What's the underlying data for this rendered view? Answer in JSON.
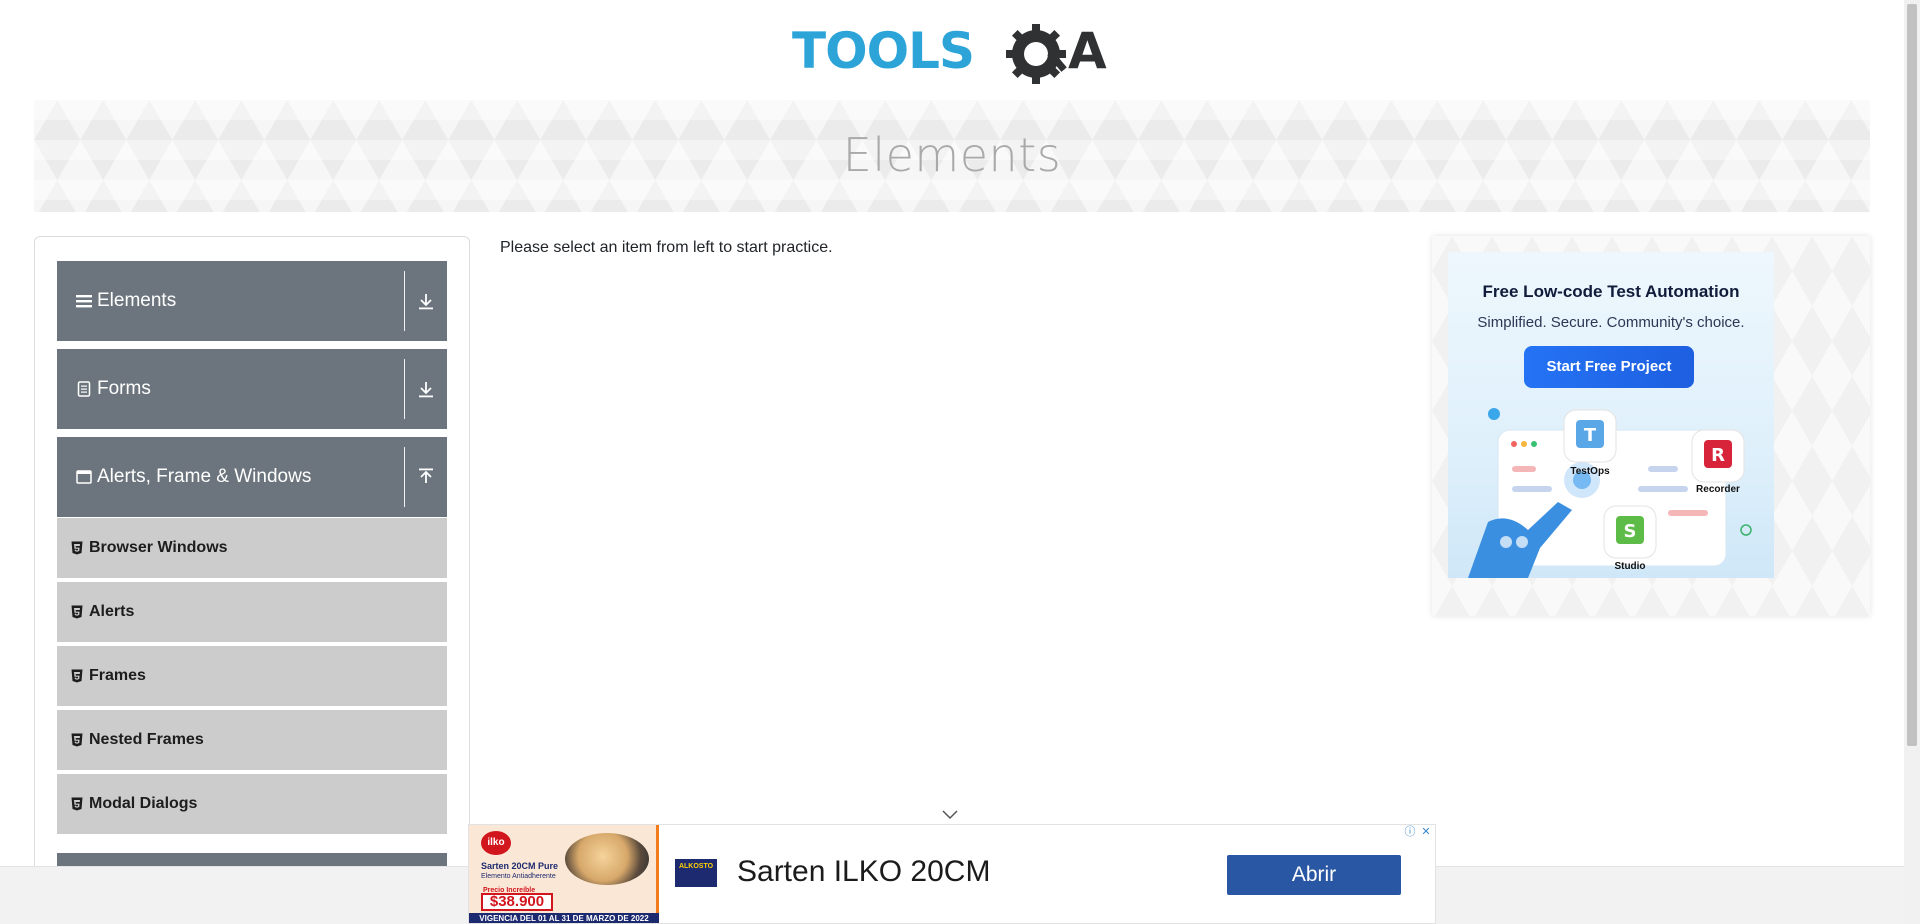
{
  "header": {
    "logo_text_left": "TOOLS",
    "logo_text_right": "A",
    "brand_color": "#2da4d8",
    "logo_dark": "#2f3133"
  },
  "banner": {
    "title": "Elements"
  },
  "sidebar": {
    "groups": [
      {
        "label": "Elements",
        "icon": "menu-lines-icon",
        "arrow": "download-arrow-icon"
      },
      {
        "label": "Forms",
        "icon": "form-doc-icon",
        "arrow": "download-arrow-icon"
      },
      {
        "label": "Alerts, Frame & Windows",
        "icon": "window-icon",
        "arrow": "upload-arrow-icon"
      }
    ],
    "items": [
      {
        "label": "Browser Windows",
        "icon": "html5-icon"
      },
      {
        "label": "Alerts",
        "icon": "html5-icon"
      },
      {
        "label": "Frames",
        "icon": "html5-icon"
      },
      {
        "label": "Nested Frames",
        "icon": "html5-icon"
      },
      {
        "label": "Modal Dialogs",
        "icon": "html5-icon"
      }
    ],
    "header_color": "#6c757d",
    "item_color": "#cccccc"
  },
  "main": {
    "message": "Please select an item from left to start practice."
  },
  "right_ad": {
    "title": "Free Low-code Test Automation",
    "subtitle": "Simplified. Secure. Community's choice.",
    "cta": "Start Free Project",
    "apps": [
      {
        "name": "TestOps",
        "letter": "T"
      },
      {
        "name": "Recorder",
        "letter": "R"
      },
      {
        "name": "Studio",
        "letter": "S"
      }
    ]
  },
  "bottom_ad": {
    "thumb_brand": "ilko",
    "thumb_line1": "Sarten 20CM Pure",
    "thumb_line2": "Elemento Antiadherente",
    "thumb_line3": "Precio Increíble",
    "thumb_price": "$38.900",
    "thumb_footer": "VIGENCIA DEL 01 AL 31 DE MARZO DE 2022",
    "store_brand": "ALKOSTO",
    "headline": "Sarten ILKO 20CM",
    "button": "Abrir"
  }
}
